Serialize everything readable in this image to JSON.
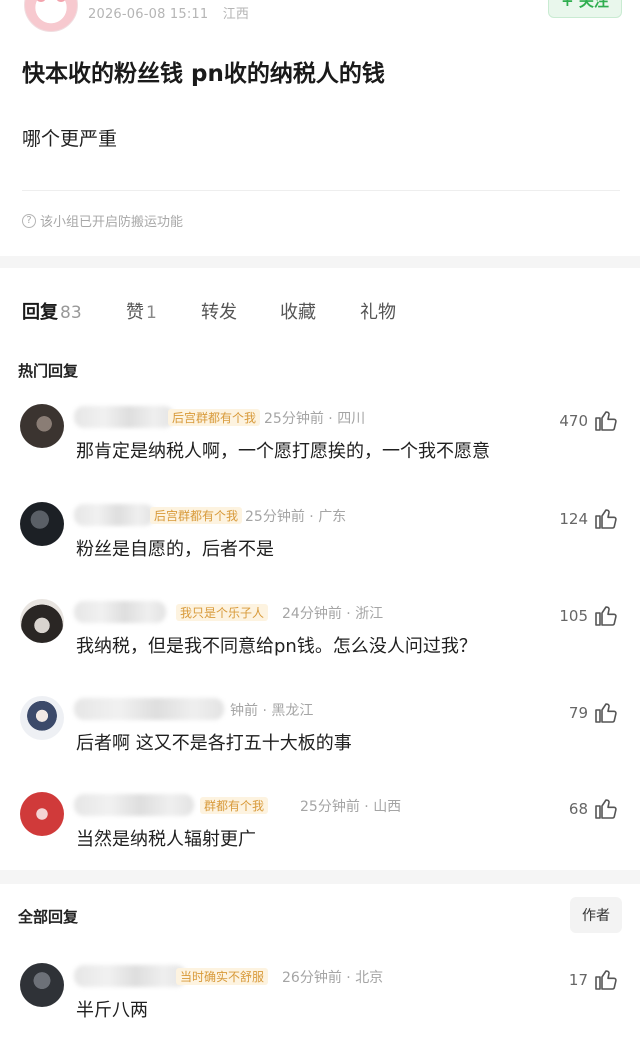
{
  "post": {
    "datetime": "2026-06-08 15:11",
    "location": "江西",
    "follow_label": "+ 关注",
    "title": "快本收的粉丝钱 pn收的纳税人的钱",
    "body": "哪个更严重",
    "notice": "该小组已开启防搬运功能",
    "notice_icon": "question-circle-icon"
  },
  "tabs": [
    {
      "label": "回复",
      "count": "83"
    },
    {
      "label": "赞",
      "count": "1"
    },
    {
      "label": "转发",
      "count": ""
    },
    {
      "label": "收藏",
      "count": ""
    },
    {
      "label": "礼物",
      "count": ""
    }
  ],
  "hot_section": {
    "title": "热门回复",
    "comments": [
      {
        "badge": "后宫群都有个我",
        "time": "25分钟前",
        "location": "四川",
        "text": "那肯定是纳税人啊，一个愿打愿挨的，一个我不愿意",
        "likes": "470"
      },
      {
        "badge": "后宫群都有个我",
        "time": "25分钟前",
        "location": "广东",
        "text": "粉丝是自愿的，后者不是",
        "likes": "124"
      },
      {
        "badge": "我只是个乐子人",
        "time": "24分钟前",
        "location": "浙江",
        "text": "我纳税，但是我不同意给pn钱。怎么没人问过我？",
        "likes": "105"
      },
      {
        "badge": "",
        "time": "钟前",
        "location": "黑龙江",
        "text": "后者啊 这又不是各打五十大板的事",
        "likes": "79"
      },
      {
        "badge": "群都有个我",
        "time": "25分钟前",
        "location": "山西",
        "text": "当然是纳税人辐射更广",
        "likes": "68"
      }
    ]
  },
  "all_section": {
    "title": "全部回复",
    "author_label": "作者",
    "comments": [
      {
        "badge": "当时确实不舒服",
        "time": "26分钟前",
        "location": "北京",
        "text": "半斤八两",
        "likes": "17"
      }
    ]
  },
  "colors": {
    "accent_green": "#2fae4f",
    "badge_text": "#d89a3a",
    "meta_gray": "#a5a5a5",
    "section_gap": "#f5f5f5"
  },
  "icons": {
    "like": "thumbs-up-icon"
  }
}
